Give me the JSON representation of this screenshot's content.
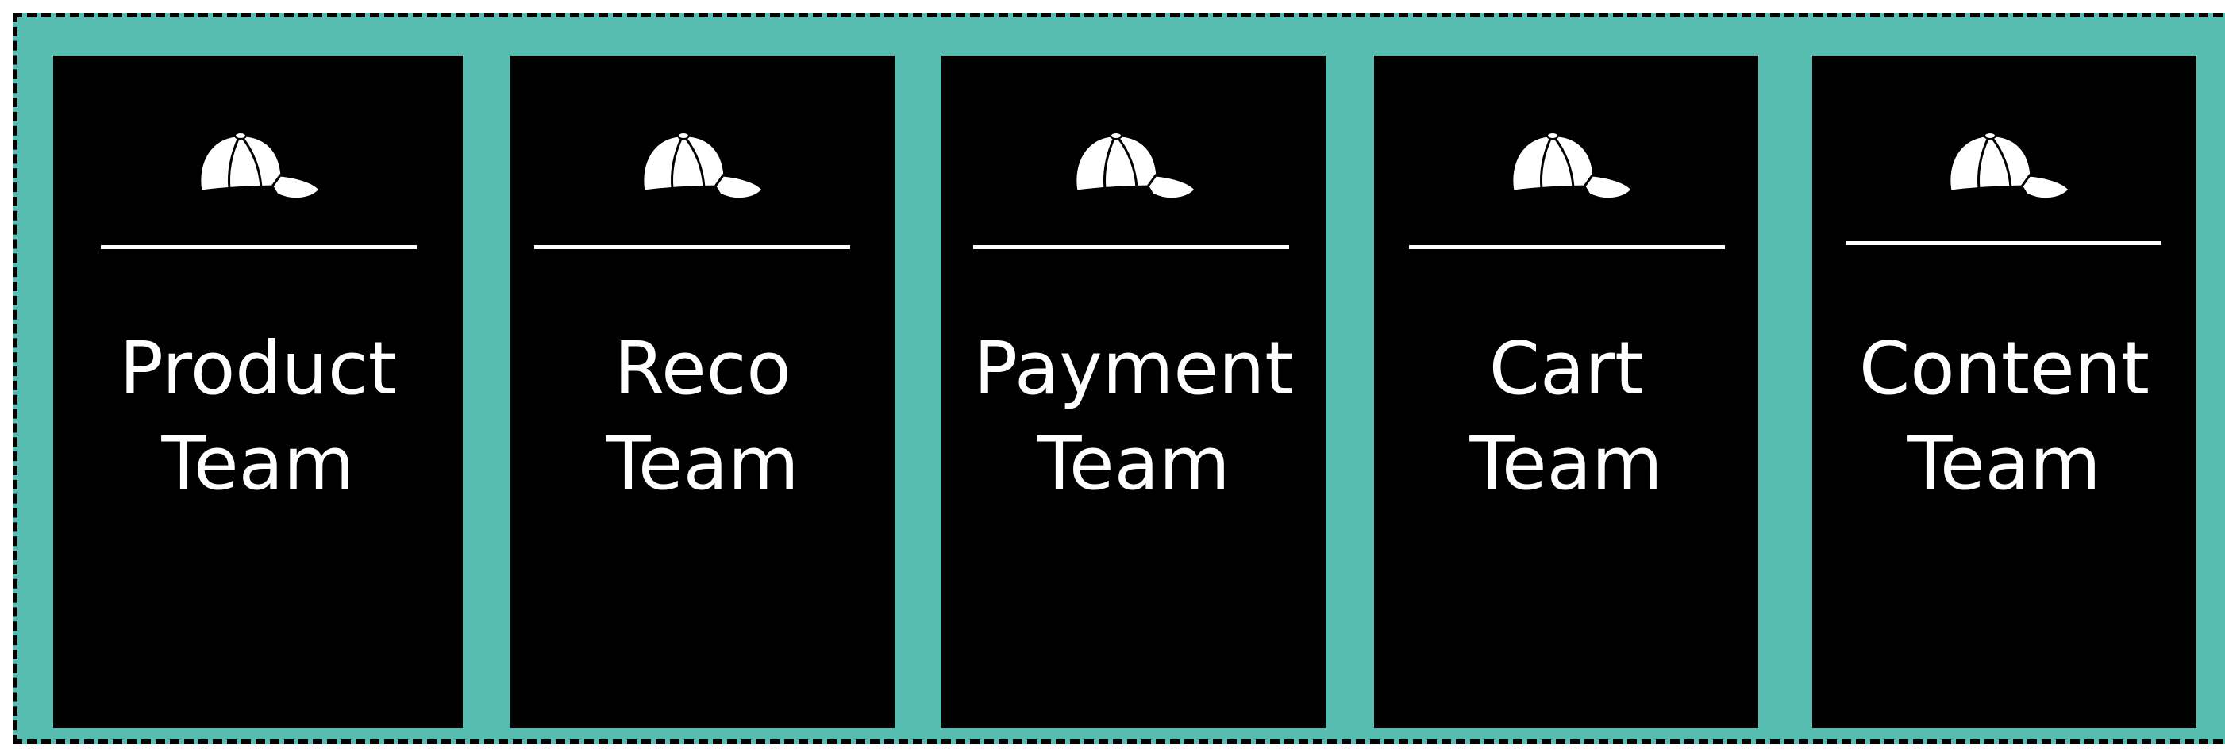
{
  "diagram": {
    "colors": {
      "group_background": "#57BDB1",
      "group_border": "#000000",
      "card_background": "#000000",
      "card_text": "#FFFFFF",
      "icon": "#FFFFFF"
    },
    "cards": [
      {
        "line1": "Product",
        "line2": "Team",
        "icon": "baseball-cap-icon"
      },
      {
        "line1": "Reco",
        "line2": "Team",
        "icon": "baseball-cap-icon"
      },
      {
        "line1": "Payment",
        "line2": "Team",
        "icon": "baseball-cap-icon"
      },
      {
        "line1": "Cart",
        "line2": "Team",
        "icon": "baseball-cap-icon"
      },
      {
        "line1": "Content",
        "line2": "Team",
        "icon": "baseball-cap-icon"
      }
    ]
  }
}
